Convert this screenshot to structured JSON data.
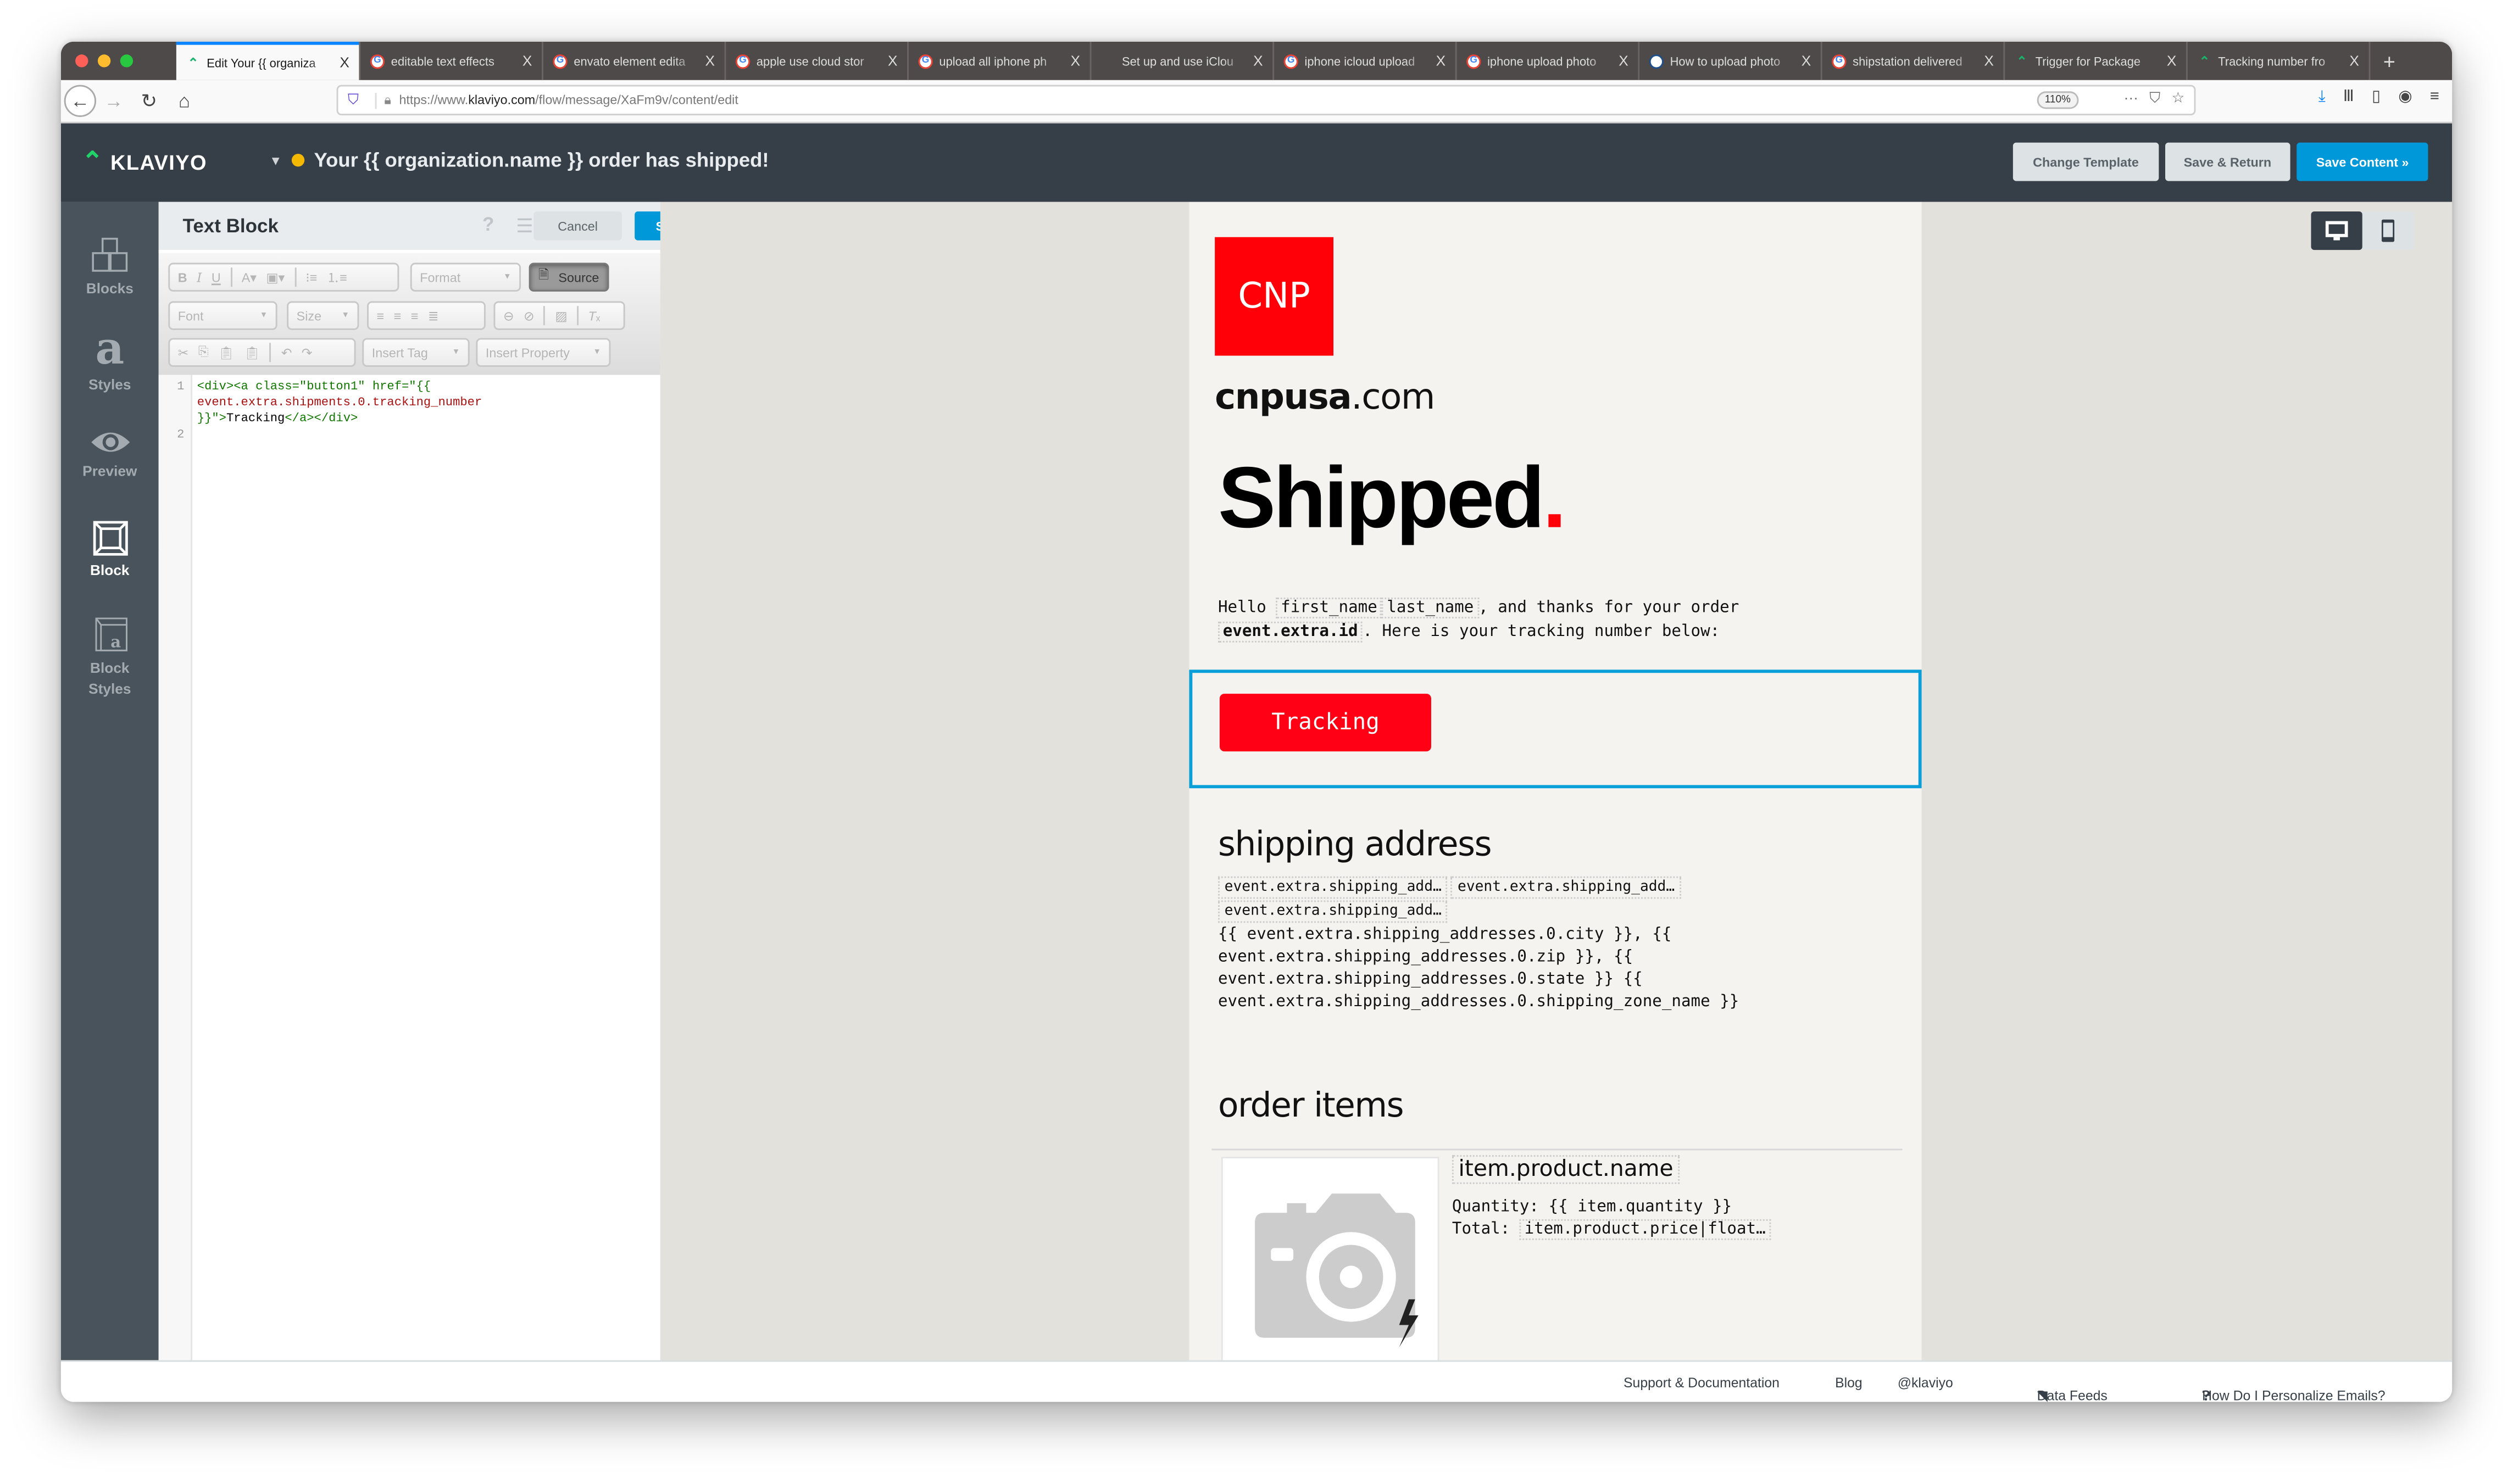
{
  "browser": {
    "tabs": [
      {
        "title": "Edit Your {{ organiza",
        "icon": "klaviyo-icon",
        "active": true
      },
      {
        "title": "editable text effects",
        "icon": "google-icon"
      },
      {
        "title": "envato element edita",
        "icon": "google-icon"
      },
      {
        "title": "apple use cloud stor",
        "icon": "google-icon"
      },
      {
        "title": "upload all iphone ph",
        "icon": "google-icon"
      },
      {
        "title": "Set up and use iClou",
        "icon": "apple-icon"
      },
      {
        "title": "iphone icloud upload",
        "icon": "google-icon"
      },
      {
        "title": "iphone upload photo",
        "icon": "google-icon"
      },
      {
        "title": "How to upload photo",
        "icon": "clock-icon"
      },
      {
        "title": "shipstation delivered",
        "icon": "google-icon"
      },
      {
        "title": "Trigger for Package",
        "icon": "klaviyo-icon"
      },
      {
        "title": "Tracking number fro",
        "icon": "klaviyo-icon"
      }
    ],
    "tab_close": "X",
    "new_tab": "+",
    "url_prefix": "https://www.",
    "url_host": "klaviyo.com",
    "url_path": "/flow/message/XaFm9v/content/edit",
    "zoom": "110%"
  },
  "header": {
    "brand": "KLAVIYO",
    "message_title": "Your {{ organization.name }} order has shipped!",
    "status_color": "#f5b800",
    "buttons": {
      "change_template": "Change Template",
      "save_return": "Save & Return",
      "save_content": "Save Content »"
    }
  },
  "rail": [
    {
      "label": "Blocks",
      "icon": "blocks-icon"
    },
    {
      "label": "Styles",
      "icon": "styles-icon"
    },
    {
      "label": "Preview",
      "icon": "eye-icon"
    },
    {
      "label": "Block",
      "icon": "cube-icon",
      "active": true
    },
    {
      "label": "Block Styles",
      "icon": "block-styles-icon"
    }
  ],
  "panel": {
    "title": "Text Block",
    "help": "?",
    "cancel": "Cancel",
    "save": "Save",
    "toolbar": {
      "format": "Format",
      "source": "Source",
      "font": "Font",
      "size": "Size",
      "insert_tag": "Insert Tag",
      "insert_property": "Insert Property"
    },
    "code": {
      "line_numbers": [
        "1",
        "2"
      ],
      "l1a": "<div><a class=\"button1\" href=\"{{",
      "l1b": "event.extra.shipments.0.tracking_number",
      "l1c": "}}\">",
      "l1d": "Tracking",
      "l1e": "</a></div>"
    }
  },
  "email": {
    "logo_text": "CNP",
    "site_bold": "cnpusa",
    "site_rest": ".com",
    "headline": "Shipped",
    "headline_period": ".",
    "intro_hello": "Hello ",
    "var_first_name": "first_name",
    "var_last_name": "last_name",
    "intro_mid": ", and thanks for your order ",
    "var_order_id": "event.extra.id",
    "intro_end": ". Here is your tracking number below:",
    "tracking_button": "Tracking",
    "shipping_heading": "shipping address",
    "address_chips": [
      "event.extra.shipping_add…",
      "event.extra.shipping_add…",
      "event.extra.shipping_add…"
    ],
    "address_lines": [
      "{{ event.extra.shipping_addresses.0.city }}, {{",
      "event.extra.shipping_addresses.0.zip }}, {{",
      "event.extra.shipping_addresses.0.state }} {{",
      "event.extra.shipping_addresses.0.shipping_zone_name }}"
    ],
    "order_heading": "order items",
    "item_name": "item.product.name",
    "quantity_line": "Quantity: {{ item.quantity }}",
    "total_label": "Total: ",
    "total_value": "item.product.price|float…",
    "brand_red": "#ff0008"
  },
  "footer": {
    "support": "Support & Documentation",
    "blog": "Blog",
    "twitter": "@klaviyo",
    "data_feeds": "Data Feeds",
    "personalize": "How Do I Personalize Emails?"
  }
}
